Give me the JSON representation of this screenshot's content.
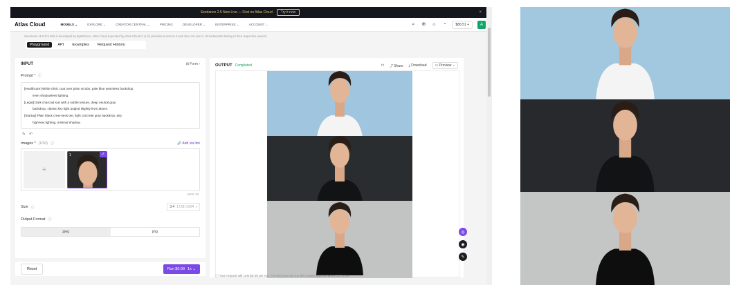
{
  "banner": {
    "text": "Seedance 2.5 Now Live — First on Atlas Cloud",
    "cta": "Try it now",
    "close": "×"
  },
  "nav": {
    "logo": "Atlas Cloud",
    "items": [
      "MODELS ⌄",
      "EXPLORE ⌄",
      "CREATOR CENTRAL ⌄",
      "PRICING",
      "DEVELOPER ⌄",
      "ENTERPRISE ⌄",
      "ACCOUNT ⌄"
    ],
    "balance": "$86.51 +",
    "avatar": "A"
  },
  "disclaimer": "Seedream v5.0 Pro Edit is developed by ByteDance. Atlas Cloud (operated by Atlas Cloud AI LLC) provides access to it and does not own it. All trademarks belong to their respective owners.",
  "tabs": [
    "Playground",
    "API",
    "Examples",
    "Request History"
  ],
  "input": {
    "title": "INPUT",
    "form_label": "⊞ Form ›",
    "prompt_label": "Prompt *",
    "prompt_lines": [
      {
        "text": "[Healthcare]  White clinic coat over plain scrubs, pale blue seamless backdrop,",
        "indent": false
      },
      {
        "text": "even shadowless lighting.",
        "indent": true
      },
      {
        "text": "[Legal]    Dark charcoal suit with a subtle texture, deep neutral gray",
        "indent": false
      },
      {
        "text": "backdrop, classic key light angled slightly from above.",
        "indent": true
      },
      {
        "text": "[Startup]   Plain black crew-neck tee, light concrete gray backdrop, airy",
        "indent": false
      },
      {
        "text": "high-key lighting, minimal shadow.",
        "indent": true
      }
    ],
    "images_label": "Images *",
    "images_count": "(1/10)",
    "add_link": "🔗 Add via link",
    "add_slot": "+",
    "thumb_num": "1",
    "max": "MAX 10",
    "size_label": "Size",
    "size_value": "3:4",
    "size_sub": "1728×2304",
    "output_format_label": "Output Format",
    "formats": [
      "jpeg",
      "png"
    ],
    "selected_format": "jpeg"
  },
  "footer": {
    "reset": "Reset",
    "run": "Run $0.09",
    "multiplier": "1x ⌄"
  },
  "output": {
    "title": "OUTPUT",
    "status": "Completed",
    "share": "Share",
    "download": "Download",
    "preview": "Preview ⌄",
    "cost_note": "Your request will cost $0.09 per run. For $10 you can run this model approximately 111 times."
  },
  "colors": {
    "accent": "#7b4ae6",
    "completed": "#1d9a5b",
    "banner_bg": "#15171c"
  }
}
